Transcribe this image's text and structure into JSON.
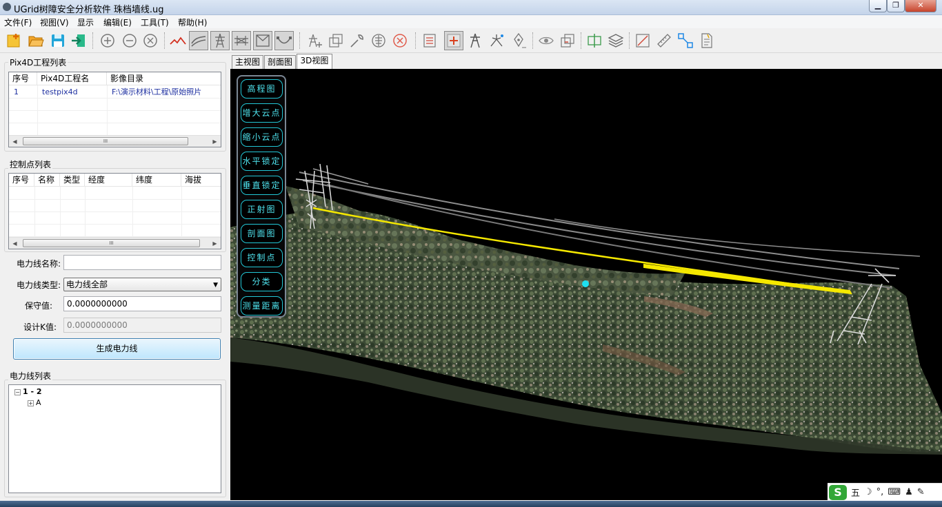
{
  "window": {
    "title": "UGrid树障安全分析软件 珠档墙线.ug",
    "min_label": "▁",
    "max_label": "❐",
    "close_label": "✕"
  },
  "menu": {
    "items": [
      "文件(F)",
      "视图(V)",
      "显示",
      "编辑(E)",
      "工具(T)",
      "帮助(H)"
    ]
  },
  "toolbar": {
    "icons": [
      "new-file-icon",
      "open-folder-icon",
      "save-icon",
      "export-icon",
      "zoom-in-icon",
      "zoom-out-icon",
      "zoom-fit-icon",
      "terrain-icon",
      "road-icon",
      "tower-frame-icon",
      "bridge-icon",
      "envelope-icon",
      "curve-icon",
      "tower-add-icon",
      "tower-edit-icon",
      "wrench-icon",
      "insulator-icon",
      "delete-icon",
      "report-icon",
      "cross-add-icon",
      "tower-icon",
      "branch-icon",
      "pen-icon",
      "eye-icon",
      "window-icon",
      "split-icon",
      "layers-icon",
      "resize-icon",
      "ruler-icon",
      "connect-icon",
      "document-icon"
    ]
  },
  "pix4d": {
    "group_title": "Pix4D工程列表",
    "columns": [
      "序号",
      "Pix4D工程名",
      "影像目录"
    ],
    "rows": [
      [
        "1",
        "testpix4d",
        "F:\\演示材料\\工程\\原始照片"
      ]
    ],
    "scroll_thumb": "III"
  },
  "control_points": {
    "group_title": "控制点列表",
    "columns": [
      "序号",
      "名称",
      "类型",
      "经度",
      "纬度",
      "海拔"
    ],
    "rows": [],
    "scroll_thumb": "III"
  },
  "form": {
    "name_label": "电力线名称:",
    "name_value": "",
    "type_label": "电力线类型:",
    "type_value": "电力线全部",
    "guard_label": "保守值:",
    "guard_value": "0.0000000000",
    "design_label": "设计K值:",
    "design_value": "0.0000000000",
    "generate_button": "生成电力线"
  },
  "powerline_list": {
    "group_title": "电力线列表",
    "root": "1 - 2",
    "child": "A"
  },
  "view_tabs": [
    "主视图",
    "剖面图",
    "3D视图"
  ],
  "active_tab": "3D视图",
  "viewport_tools": [
    "高程图",
    "增大云点",
    "缩小云点",
    "水平锁定",
    "垂直锁定",
    "正射图",
    "剖面图",
    "控制点",
    "分类",
    "测量距离"
  ],
  "ime": {
    "logo": "S",
    "mode": "五",
    "moon": "☽",
    "punct": "°,",
    "keyboard": "⌨",
    "person": "♟",
    "tool": "✎"
  },
  "colors": {
    "powerline_highlight": "#f5e800",
    "tool_button_text": "#4fe3ee",
    "marker": "#1ee0f0"
  }
}
